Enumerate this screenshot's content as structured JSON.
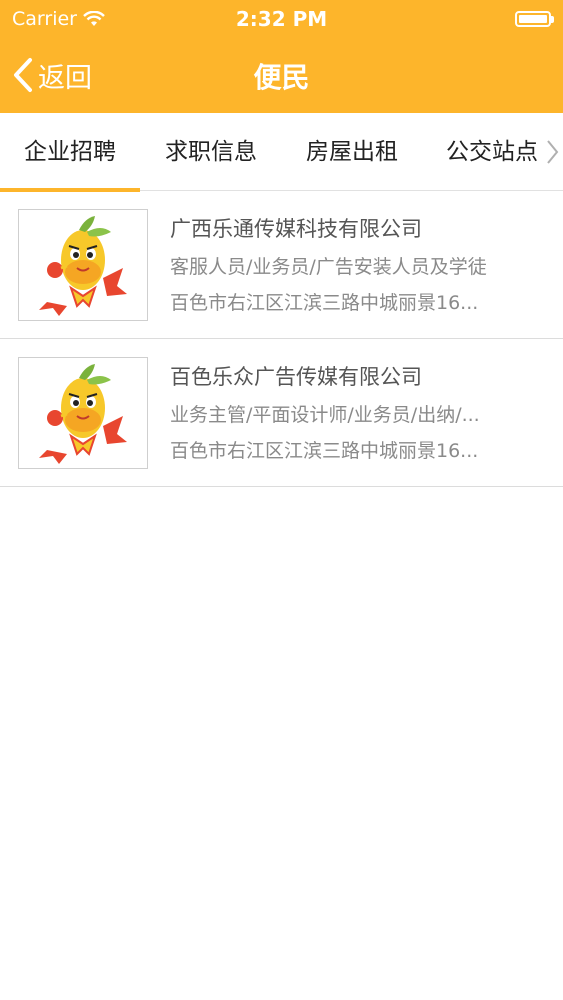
{
  "status_bar": {
    "carrier": "Carrier",
    "time": "2:32 PM"
  },
  "nav": {
    "back_label": "返回",
    "title": "便民"
  },
  "tabs": [
    "企业招聘",
    "求职信息",
    "房屋出租",
    "公交站点"
  ],
  "jobs": [
    {
      "company": "广西乐通传媒科技有限公司",
      "positions": "客服人员/业务员/广告安装人员及学徒",
      "address": "百色市右江区江滨三路中城丽景16..."
    },
    {
      "company": "百色乐众广告传媒有限公司",
      "positions": "业务主管/平面设计师/业务员/出纳/...",
      "address": "百色市右江区江滨三路中城丽景16..."
    }
  ],
  "colors": {
    "accent": "#fdb52b"
  }
}
